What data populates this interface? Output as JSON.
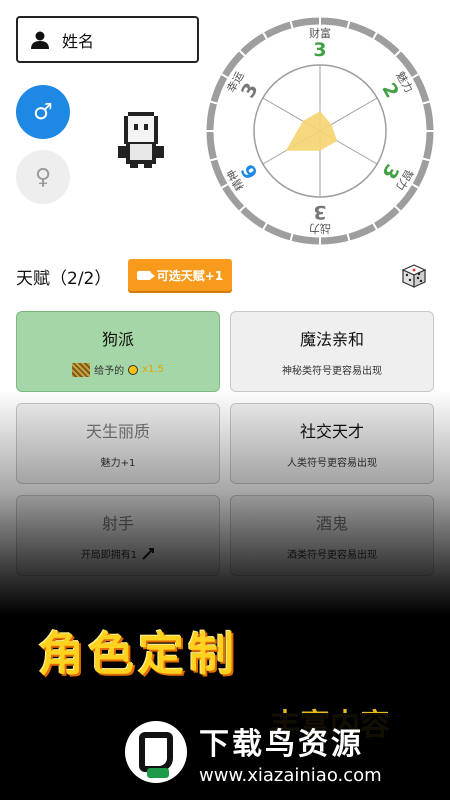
{
  "profile": {
    "name_placeholder": "姓名",
    "gender_male_icon": "♂",
    "gender_female_icon": "♀"
  },
  "radar": {
    "stats": [
      {
        "label": "财富",
        "value": "3",
        "color": "#43a047"
      },
      {
        "label": "魅力",
        "value": "2",
        "color": "#43a047"
      },
      {
        "label": "智力",
        "value": "3",
        "color": "#43a047"
      },
      {
        "label": "战力",
        "value": "3",
        "color": "#777777"
      },
      {
        "label": "精神",
        "value": "6",
        "color": "#1e88e5"
      },
      {
        "label": "幸运",
        "value": "3",
        "color": "#777777"
      }
    ],
    "max": 10,
    "fill_color": "#f5d470"
  },
  "talents": {
    "title": "天赋（2/2）",
    "ad_button": "可选天赋+1",
    "dice_icon": "dice-icon",
    "cards": [
      {
        "title": "狗派",
        "desc_prefix": "给予的",
        "desc_suffix": "x1.5",
        "selected": true
      },
      {
        "title": "魔法亲和",
        "desc": "神秘类符号更容易出现",
        "selected": false
      },
      {
        "title": "天生丽质",
        "desc": "魅力+1",
        "selected": false
      },
      {
        "title": "社交天才",
        "desc": "人类符号更容易出现",
        "selected": false
      },
      {
        "title": "射手",
        "desc": "开局即拥有1",
        "selected": false
      },
      {
        "title": "酒鬼",
        "desc": "酒类符号更容易出现",
        "selected": false
      }
    ]
  },
  "promo": {
    "headline": "角色定制",
    "sub": "丰富内容"
  },
  "watermark": {
    "name": "下载鸟资源",
    "url": "www.xiazainiao.com"
  }
}
